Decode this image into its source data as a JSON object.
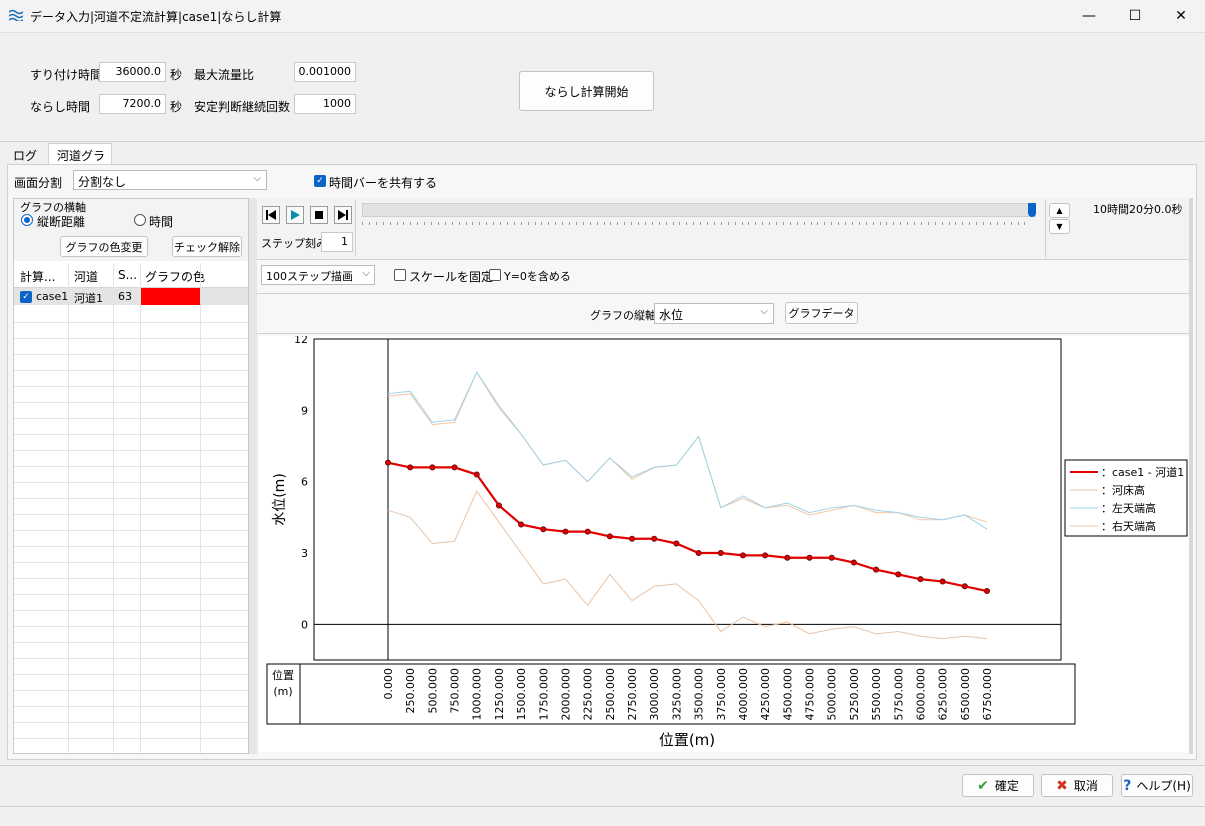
{
  "window": {
    "title": "データ入力|河道不定流計算|case1|ならし計算",
    "minimize": "—",
    "maximize": "☐",
    "close": "✕"
  },
  "params": {
    "sync_time_label": "すり付け時間",
    "sync_time_value": "36000.0",
    "sync_time_unit": "秒",
    "smooth_time_label": "ならし時間",
    "smooth_time_value": "7200.0",
    "smooth_time_unit": "秒",
    "max_flow_ratio_label": "最大流量比",
    "max_flow_ratio_value": "0.001000",
    "stable_count_label": "安定判断継続回数",
    "stable_count_value": "1000",
    "start_button": "ならし計算開始"
  },
  "tabs": [
    {
      "label": "ログ",
      "active": false
    },
    {
      "label": "河道グラフ",
      "active": true
    }
  ],
  "screen_split": {
    "label": "画面分割",
    "value": "分割なし",
    "share_timebar_label": "時間バーを共有する",
    "share_timebar_checked": true
  },
  "axis_group": {
    "title": "グラフの横軸",
    "option_distance": "縦断距離",
    "option_time": "時間",
    "selected": "縦断距離"
  },
  "left_buttons": {
    "color_change": "グラフの色変更",
    "uncheck": "チェック解除"
  },
  "table": {
    "headers": [
      "計算...",
      "河道",
      "S...",
      "グラフの色"
    ],
    "rows": [
      {
        "checked": true,
        "calc": "case1",
        "river": "河道1",
        "s": "63",
        "color": "#ff0000"
      }
    ]
  },
  "playback": {
    "step_label": "ステップ刻み",
    "step_value": "1",
    "time_display": "10時間20分0.0秒",
    "slider_position": 1.0
  },
  "draw_options": {
    "draw_steps": "100ステップ描画",
    "fix_scale_label": "スケールを固定",
    "include_zero_label": "Y=0を含める"
  },
  "vertical_axis": {
    "label": "グラフの縦軸",
    "value": "水位",
    "data_button": "グラフデータ"
  },
  "chart_data": {
    "type": "line",
    "xlabel": "位置(m)",
    "ylabel": "水位(m)",
    "x_table_header": "位置\n(m)",
    "ylim": [
      -1.5,
      12
    ],
    "yticks": [
      0,
      3,
      6,
      9,
      12
    ],
    "x_tick_labels": [
      "0.000",
      "250.000",
      "500.000",
      "750.000",
      "1000.000",
      "1250.000",
      "1500.000",
      "1750.000",
      "2000.000",
      "2250.000",
      "2500.000",
      "2750.000",
      "3000.000",
      "3250.000",
      "3500.000",
      "3750.000",
      "4000.000",
      "4250.000",
      "4500.000",
      "4750.000",
      "5000.000",
      "5250.000",
      "5500.000",
      "5750.000",
      "6000.000",
      "6250.000",
      "6500.000",
      "6750.000"
    ],
    "x": [
      0,
      250,
      500,
      750,
      1000,
      1250,
      1500,
      1750,
      2000,
      2250,
      2500,
      2750,
      3000,
      3250,
      3500,
      3750,
      4000,
      4250,
      4500,
      4750,
      5000,
      5250,
      5500,
      5750,
      6000,
      6250,
      6500,
      6750
    ],
    "series": [
      {
        "name": "case1 - 河道1",
        "color": "#e00000",
        "values": [
          6.8,
          6.6,
          6.6,
          6.6,
          6.3,
          5.0,
          4.2,
          4.0,
          3.9,
          3.9,
          3.7,
          3.6,
          3.6,
          3.4,
          3.0,
          3.0,
          2.9,
          2.9,
          2.8,
          2.8,
          2.8,
          2.6,
          2.3,
          2.1,
          1.9,
          1.8,
          1.6,
          1.4
        ]
      },
      {
        "name": "河床高",
        "color": "#e8c4a8",
        "values": [
          4.8,
          4.5,
          3.4,
          3.5,
          5.6,
          4.3,
          3.0,
          1.7,
          1.9,
          0.8,
          2.1,
          1.0,
          1.6,
          1.7,
          1.0,
          -0.3,
          0.3,
          -0.1,
          0.1,
          -0.4,
          -0.2,
          -0.1,
          -0.4,
          -0.3,
          -0.5,
          -0.6,
          -0.5,
          -0.6
        ]
      },
      {
        "name": "左天端高",
        "color": "#9ed2e8",
        "values": [
          9.7,
          9.8,
          8.5,
          8.6,
          10.6,
          9.2,
          8.0,
          6.7,
          6.9,
          6.0,
          7.0,
          6.2,
          6.6,
          6.7,
          7.9,
          4.9,
          5.4,
          4.9,
          5.1,
          4.7,
          4.9,
          5.0,
          4.8,
          4.7,
          4.5,
          4.4,
          4.6,
          4.0
        ]
      },
      {
        "name": "右天端高",
        "color": "#f2c7a4",
        "values": [
          9.6,
          9.7,
          8.4,
          8.5,
          10.6,
          9.1,
          8.0,
          6.7,
          6.9,
          6.0,
          7.0,
          6.1,
          6.6,
          6.7,
          7.9,
          4.9,
          5.3,
          4.9,
          5.0,
          4.6,
          4.8,
          5.0,
          4.7,
          4.7,
          4.4,
          4.4,
          4.6,
          4.3
        ]
      }
    ]
  },
  "legend_items": [
    {
      "label": "：case1 - 河道1",
      "color": "#e00000"
    },
    {
      "label": "：河床高",
      "color": "#e8c4a8"
    },
    {
      "label": "：左天端高",
      "color": "#9ed2e8"
    },
    {
      "label": "：右天端高",
      "color": "#f2c7a4"
    }
  ],
  "footer": {
    "ok": "確定",
    "cancel": "取消",
    "help": "ヘルプ(H)"
  }
}
